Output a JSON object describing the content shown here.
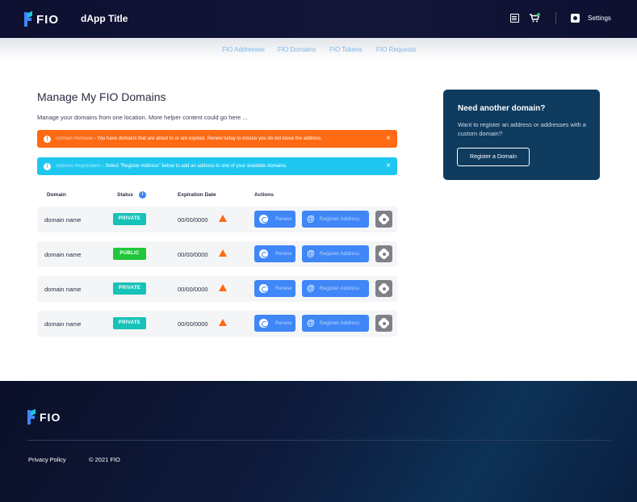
{
  "header": {
    "logo_text": "FIO",
    "app_title": "dApp Title",
    "settings_label": "Settings"
  },
  "subnav": {
    "items": [
      {
        "label": "FIO Addresses"
      },
      {
        "label": "FIO Domains"
      },
      {
        "label": "FIO Tokens"
      },
      {
        "label": "FIO Requests"
      }
    ]
  },
  "main": {
    "title": "Manage My FIO Domains",
    "subtitle": "Manage your domains from one location. More helper content could go here ...",
    "alerts": [
      {
        "type": "warning",
        "icon": "!",
        "title": "Domain Renewal",
        "message": " - You have domains that are about to or are expired. Renew today to ensure you do not loose the address.",
        "close": "×"
      },
      {
        "type": "info",
        "icon": "!",
        "title": "Address Registration",
        "message": " - Select \"Register Address\" below to add an address to one of your available domains.",
        "close": "×"
      }
    ],
    "table": {
      "headers": {
        "domain": "Domain",
        "status": "Status",
        "expiration": "Expiration Date",
        "actions": "Actions"
      },
      "info_icon": "i",
      "rows": [
        {
          "domain": "domain name",
          "status": "PRIVATE",
          "expiration": "00/00/0000",
          "renew": "Renew",
          "register": "Register Address"
        },
        {
          "domain": "domain name",
          "status": "PUBLIC",
          "expiration": "00/00/0000",
          "renew": "Renew",
          "register": "Register Address"
        },
        {
          "domain": "domain name",
          "status": "PRIVATE",
          "expiration": "00/00/0000",
          "renew": "Renew",
          "register": "Register Address"
        },
        {
          "domain": "domain name",
          "status": "PRIVATE",
          "expiration": "00/00/0000",
          "renew": "Renew",
          "register": "Register Address"
        }
      ]
    }
  },
  "side_card": {
    "title": "Need another domain?",
    "text": "Want to register an address or addresses with a custom domain?",
    "button": "Register a Domain"
  },
  "footer": {
    "logo_text": "FIO",
    "privacy": "Privacy Policy",
    "copyright": "© 2021 FIO"
  },
  "colors": {
    "header_bg": "#0d1030",
    "accent_blue": "#3f86f7",
    "warning_orange": "#ff6a13",
    "info_cyan": "#1ec7f0",
    "private_badge": "#17c2b8",
    "public_badge": "#21c73a",
    "card_bg": "#0e3b5e",
    "gear_button": "#7f8088"
  }
}
